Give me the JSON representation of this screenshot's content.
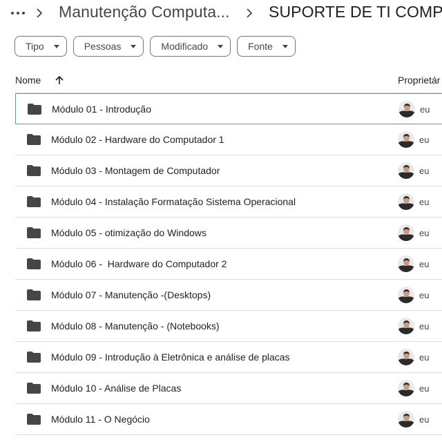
{
  "breadcrumb": {
    "more_icon": "more-horiz-icon",
    "items": [
      "Manutenção Computa...",
      "SUPORTE DE TI COMPL..."
    ]
  },
  "filters": [
    {
      "label": "Tipo"
    },
    {
      "label": "Pessoas"
    },
    {
      "label": "Modificado"
    },
    {
      "label": "Fonte"
    }
  ],
  "table": {
    "columns": {
      "name": "Nome",
      "owner": "Proprietár"
    },
    "sort": "arrow-up-icon",
    "rows": [
      {
        "name": "Módulo 01 - Introdução",
        "owner": "eu",
        "selected": true
      },
      {
        "name": "Módulo 02 - Hardware do Computador 1",
        "owner": "eu"
      },
      {
        "name": "Módulo 03 - Montagem de Computador",
        "owner": "eu"
      },
      {
        "name": "Módulo 04 - Instalação Formatação Sistema Operacional",
        "owner": "eu"
      },
      {
        "name": "Módulo 05 - otimização do Windows",
        "owner": "eu"
      },
      {
        "name": "Módulo 06 -  Hardware do Computador 2",
        "owner": "eu"
      },
      {
        "name": "Módulo 07 - Manutenção -(Desktops)",
        "owner": "eu"
      },
      {
        "name": "Módulo 08 - Manutenção - (Notebooks)",
        "owner": "eu"
      },
      {
        "name": "Módulo 09 - Introdução à Eletrônica e análise de placas",
        "owner": "eu"
      },
      {
        "name": "Módulo 10 - Análise de Placas",
        "owner": "eu"
      },
      {
        "name": "Módulo 11 - O Negócio",
        "owner": "eu"
      }
    ]
  },
  "colors": {
    "folder": "#444746",
    "selection_border": "#5f8fd6",
    "divider": "#dadce0"
  }
}
